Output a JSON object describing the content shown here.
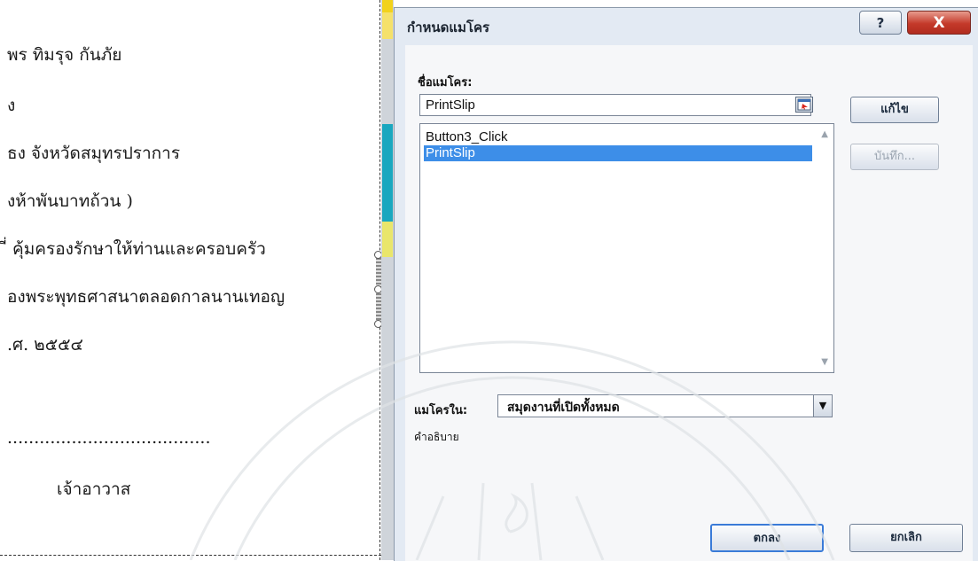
{
  "document": {
    "lines": [
      "พร ทิมรุจ กันภัย",
      "ง",
      "ธง จังหวัดสมุทรปราการ",
      "งห้าพันบาทถ้วน            )",
      "ี่ คุ้มครองรักษาให้ท่านและครอบครัว",
      "องพระพุทธศาสนาตลอดกาลนานเทอญ",
      ".ศ.     ๒๕๕๔",
      "......................................",
      "เจ้าอาวาส"
    ]
  },
  "dialog": {
    "title": "กำหนดแมโคร",
    "help_label": "?",
    "close_label": "X",
    "macro_name_label": "ชื่อแมโคร:",
    "macro_name_value": "PrintSlip",
    "macros": [
      "Button3_Click",
      "PrintSlip"
    ],
    "selected_macro": "PrintSlip",
    "edit_button": "แก้ไข",
    "save_button": "บันทึก...",
    "macros_in_label": "แมโครใน:",
    "macros_in_value": "สมุดงานที่เปิดทั้งหมด",
    "description_label": "คำอธิบาย",
    "ok_button": "ตกลง",
    "cancel_button": "ยกเลิก"
  },
  "colors": {
    "selection": "#3d8ee8",
    "dialog_bg": "#e3eaf3",
    "close_button": "#c4392a"
  }
}
